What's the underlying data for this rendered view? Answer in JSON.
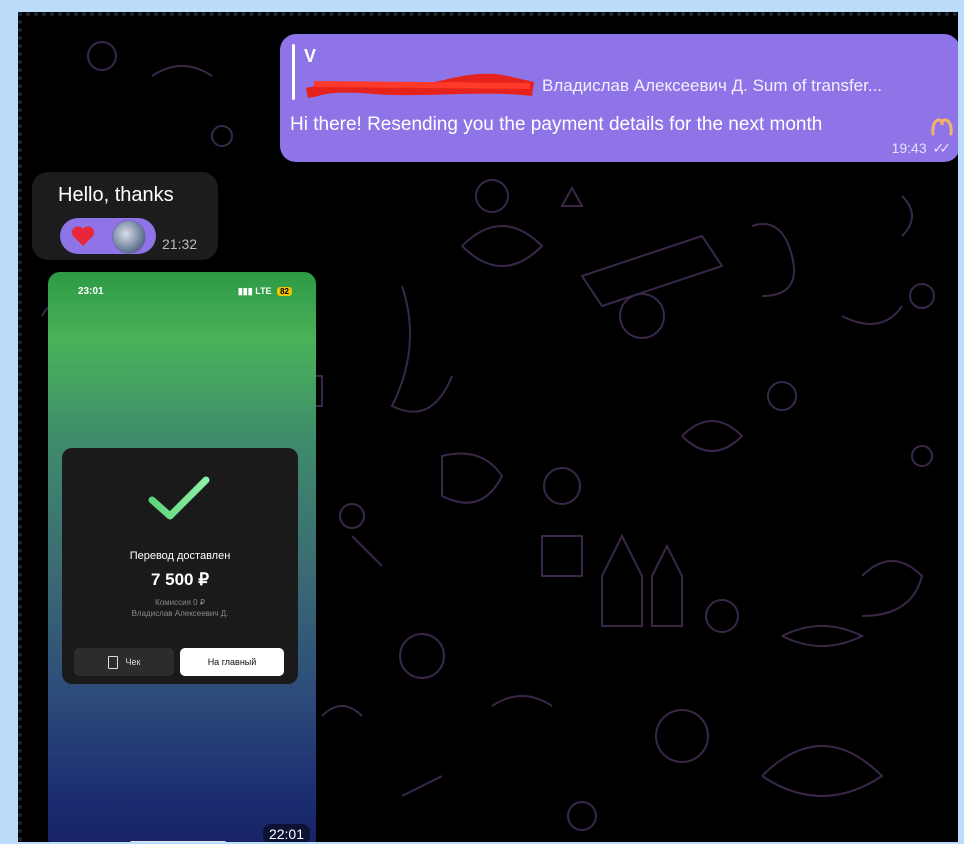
{
  "outgoing": {
    "reply_sender": "V",
    "reply_preview": "Владислав Алексеевич Д. Sum of transfer...",
    "text": "Hi there! Resending you the payment details for the next month",
    "time": "19:43",
    "emoji": "pinching-hands-icon"
  },
  "incoming": {
    "text": "Hello, thanks",
    "time": "21:32",
    "reaction": "heart-icon"
  },
  "screenshot": {
    "status_time": "23:01",
    "network": "LTE",
    "battery": "82",
    "title": "Перевод доставлен",
    "amount": "7 500 ₽",
    "fee": "Комиссия 0 ₽",
    "recipient": "Владислав Алексеевич Д.",
    "check_button": "Чек",
    "home_button": "На главный",
    "time": "22:01"
  },
  "colors": {
    "bubble_out": "#8e74e6",
    "bubble_in": "#1c1c1e",
    "redaction": "#e5221b"
  }
}
